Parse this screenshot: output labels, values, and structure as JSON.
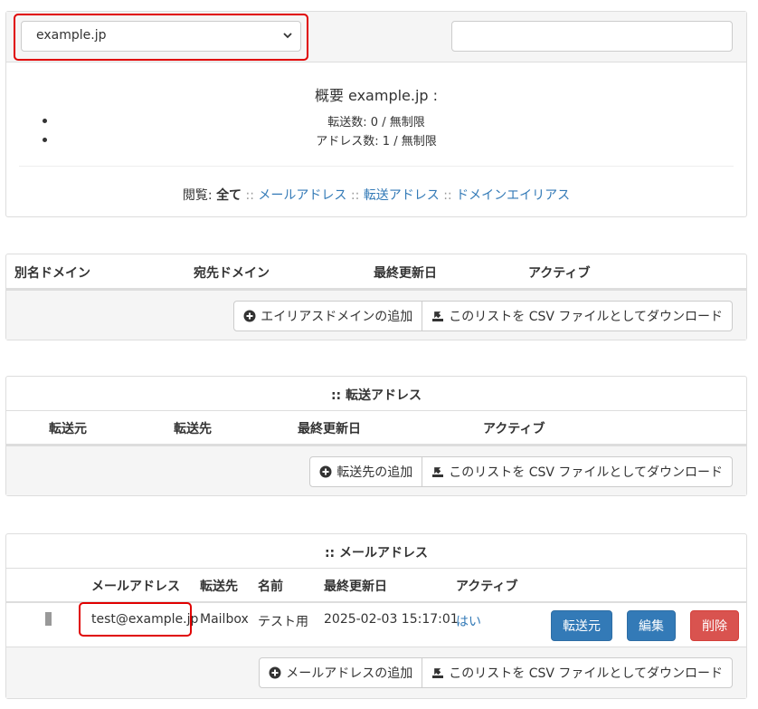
{
  "domain_select": {
    "value": "example.jp"
  },
  "search": {
    "placeholder": ""
  },
  "overview": {
    "title": "概要 example.jp :",
    "items": [
      "転送数: 0 / 無制限",
      "アドレス数: 1 / 無制限"
    ],
    "view_label": "閲覧:",
    "view_all": "全て",
    "sep": "::",
    "view_links": [
      "メールアドレス",
      "転送アドレス",
      "ドメインエイリアス"
    ]
  },
  "alias_domains": {
    "headers": [
      "別名ドメイン",
      "宛先ドメイン",
      "最終更新日",
      "アクティブ"
    ],
    "add_button": "エイリアスドメインの追加",
    "csv_button": "このリストを CSV ファイルとしてダウンロード"
  },
  "forwarding": {
    "title": ":: 転送アドレス",
    "headers": [
      "転送元",
      "転送先",
      "最終更新日",
      "アクティブ"
    ],
    "add_button": "転送先の追加",
    "csv_button": "このリストを CSV ファイルとしてダウンロード"
  },
  "mailboxes": {
    "title": ":: メールアドレス",
    "headers": [
      "メールアドレス",
      "転送先",
      "名前",
      "最終更新日",
      "アクティブ"
    ],
    "rows": [
      {
        "address": "test@example.jp",
        "forward": "Mailbox",
        "name": "テスト用",
        "modified": "2025-02-03 15:17:01",
        "active": "はい",
        "buttons": [
          "転送元",
          "編集",
          "削除"
        ]
      }
    ],
    "add_button": "メールアドレスの追加",
    "csv_button": "このリストを CSV ファイルとしてダウンロード"
  },
  "colors": {
    "primary": "#337ab7",
    "danger": "#d9534f",
    "highlight": "#e00000",
    "link": "#337ab7"
  }
}
